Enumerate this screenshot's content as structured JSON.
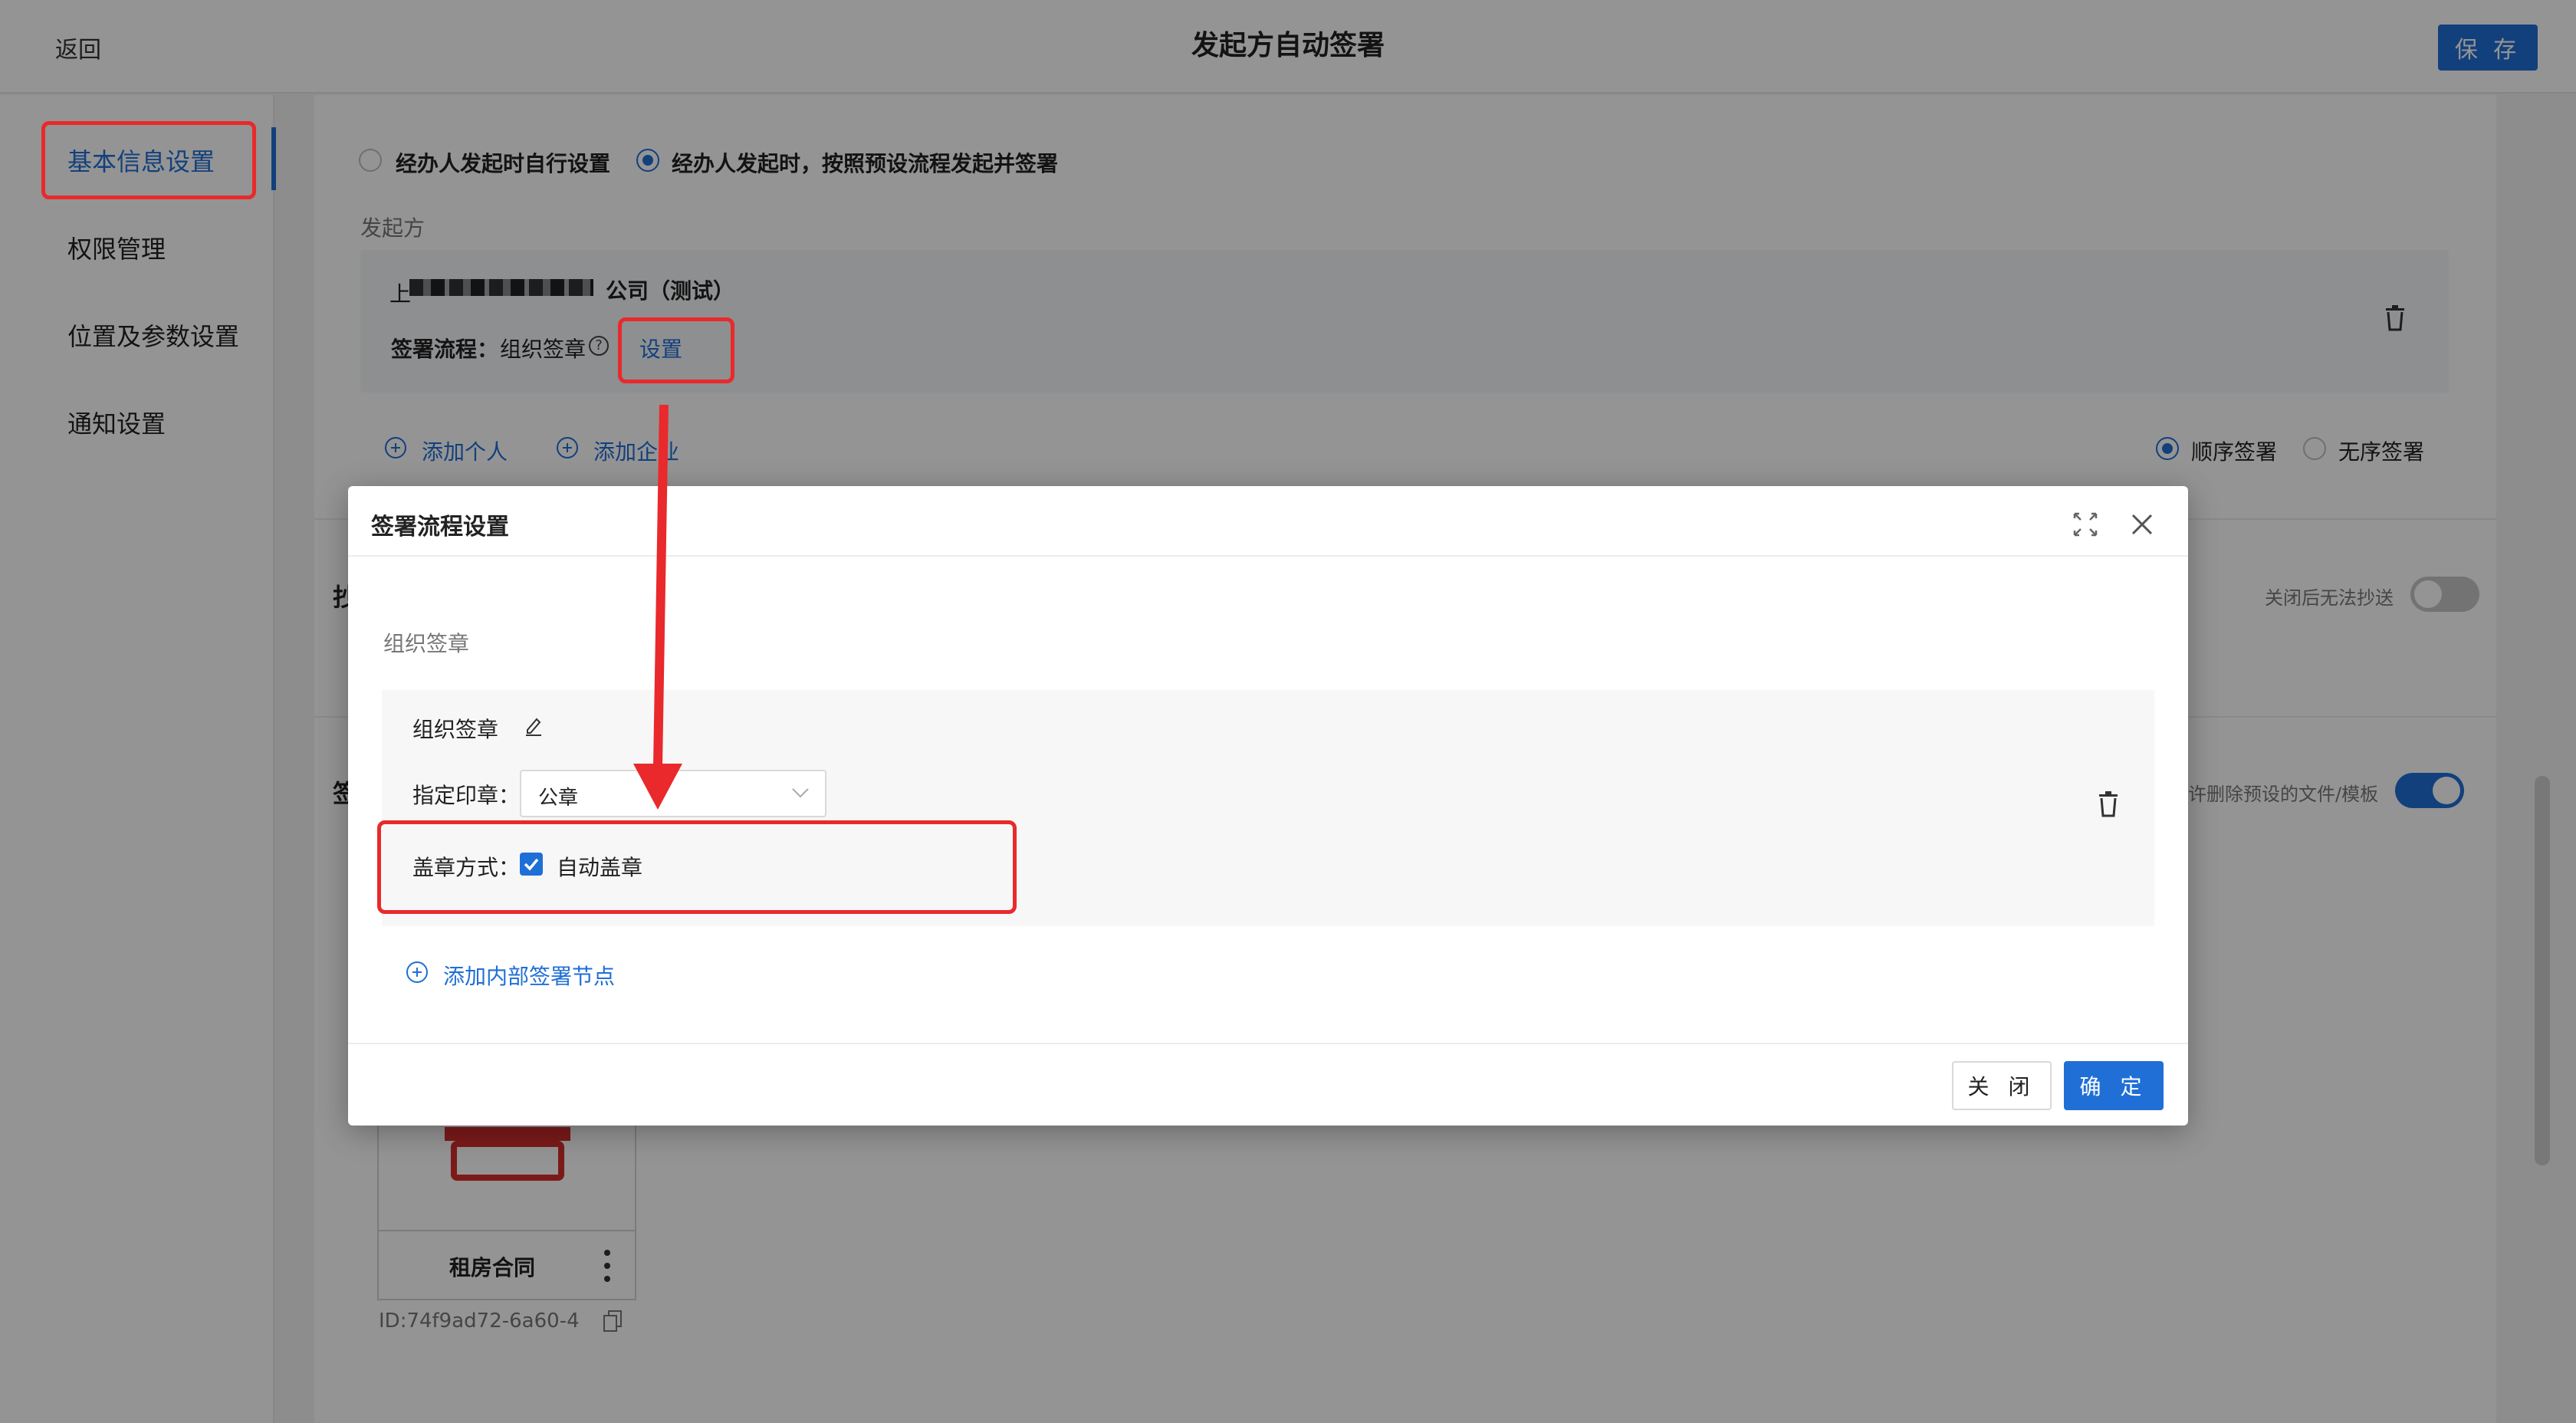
{
  "header": {
    "back_label": "返回",
    "title": "发起方自动签署",
    "save_label": "保 存"
  },
  "sidebar": {
    "items": [
      {
        "label": "基本信息设置",
        "active": true
      },
      {
        "label": "权限管理"
      },
      {
        "label": "位置及参数设置"
      },
      {
        "label": "通知设置"
      }
    ]
  },
  "section1": {
    "radio_option_1": "经办人发起时自行设置",
    "radio_option_2": "经办人发起时，按照预设流程发起并签署",
    "selected_option": 2,
    "initiator_label": "发起方",
    "company_suffix": "公司（测试）",
    "company_prefix": "上",
    "flow_label": "签署流程：",
    "flow_value": "组织签章",
    "flow_setting_link": "设置",
    "add_person": "添加个人",
    "add_company": "添加企业",
    "order_sign": "顺序签署",
    "unordered_sign": "无序签署"
  },
  "section2": {
    "title_char": "抄",
    "toggle_label": "关闭后无法抄送",
    "toggle_on": false
  },
  "section3": {
    "title_char": "签",
    "toggle_label": "许删除预设的文件/模板",
    "toggle_on": true,
    "file_card": {
      "name": "租房合同",
      "id_text": "ID:74f9ad72-6a60-4"
    }
  },
  "modal": {
    "title": "签署流程设置",
    "section_label": "组织签章",
    "node_title": "组织签章",
    "seal_label": "指定印章：",
    "seal_value": "公章",
    "stamp_method_label": "盖章方式：",
    "stamp_method_value": "自动盖章",
    "auto_stamp_checked": true,
    "add_node_label": "添加内部签署节点",
    "close_label": "关 闭",
    "ok_label": "确 定"
  },
  "colors": {
    "accent": "#1f6fd6",
    "annotation_red": "#e9292b"
  }
}
